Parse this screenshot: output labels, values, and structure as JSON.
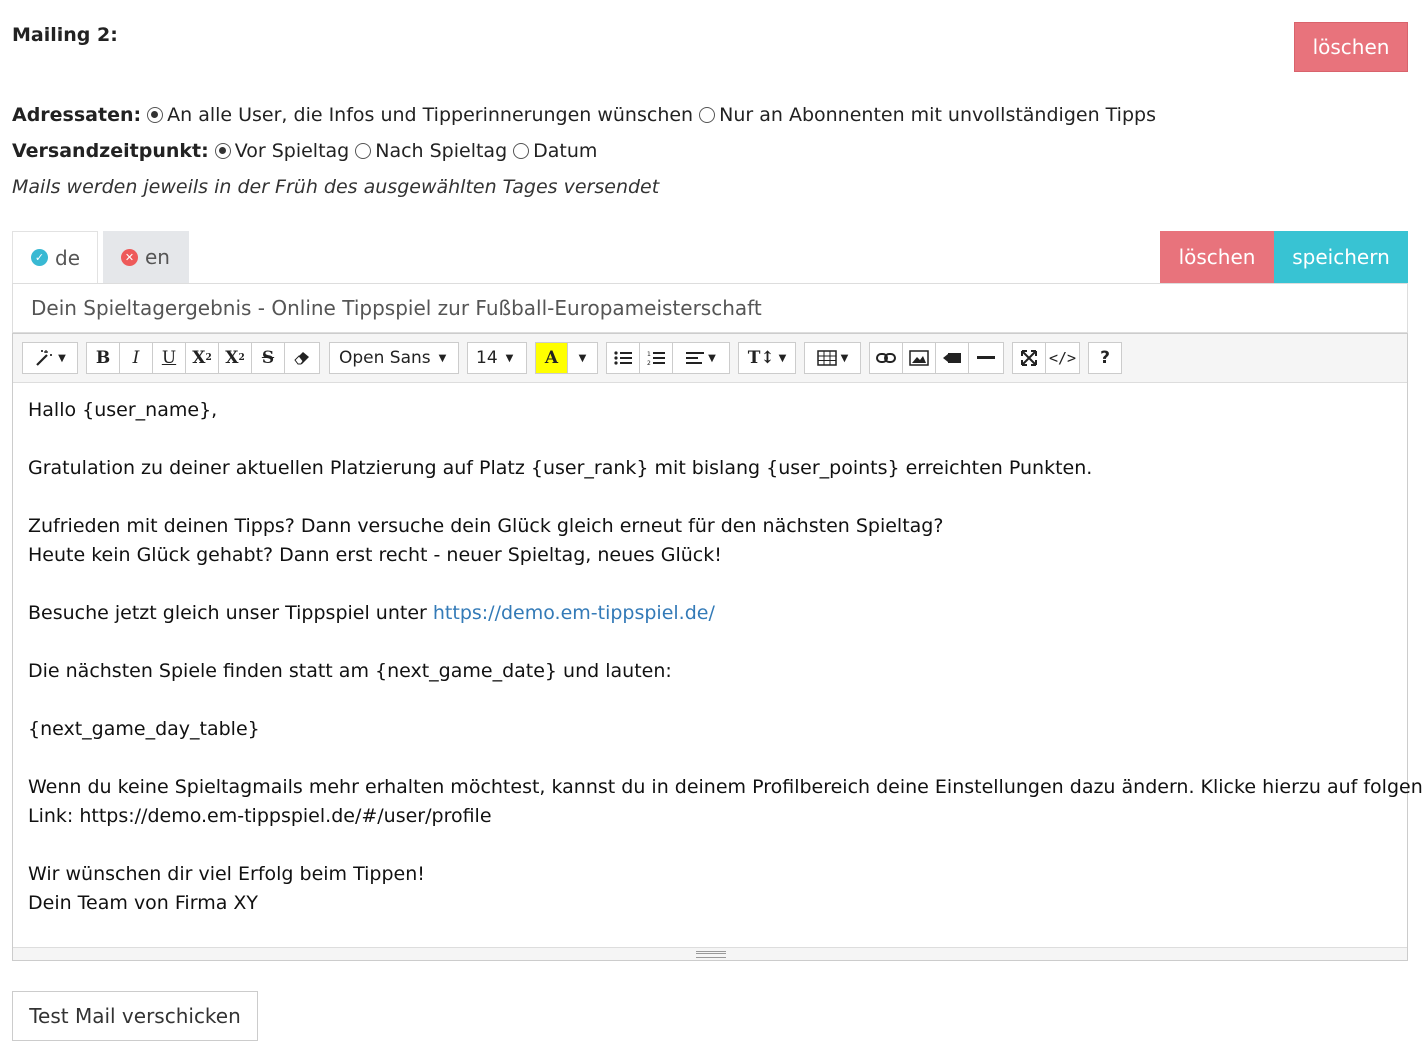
{
  "title": "Mailing 2:",
  "delete_top_label": "löschen",
  "recipients": {
    "label": "Adressaten:",
    "options": [
      "An alle User, die Infos und Tipperinnerungen wünschen",
      "Nur an Abonnenten mit unvollständigen Tipps"
    ],
    "selected": 0
  },
  "send_time": {
    "label": "Versandzeitpunkt:",
    "options": [
      "Vor Spieltag",
      "Nach Spieltag",
      "Datum"
    ],
    "selected": 0
  },
  "note": "Mails werden jeweils in der Früh des ausgewählten Tages versendet",
  "tabs": [
    {
      "label": "de",
      "status": "complete"
    },
    {
      "label": "en",
      "status": "missing"
    }
  ],
  "actions": {
    "delete_label": "löschen",
    "save_label": "speichern"
  },
  "subject": "Dein Spieltagergebnis - Online Tippspiel zur Fußball-Europameisterschaft",
  "toolbar": {
    "font_family": "Open Sans",
    "font_size": "14"
  },
  "body": {
    "greeting": "Hallo {user_name},",
    "congrats": "Gratulation zu deiner aktuellen Platzierung auf Platz {user_rank} mit bislang {user_points} erreichten Punkten.",
    "line3": "Zufrieden mit deinen Tipps? Dann versuche dein Glück gleich erneut für den nächsten Spieltag?",
    "line4": "Heute kein Glück gehabt? Dann erst recht - neuer Spieltag, neues Glück!",
    "visit_prefix": "Besuche jetzt gleich unser Tippspiel unter ",
    "visit_link": "https://demo.em-tippspiel.de/",
    "next_games": "Die nächsten Spiele finden statt am {next_game_date} und lauten:",
    "table_placeholder": "{next_game_day_table}",
    "unsubscribe_1": "Wenn du keine Spieltagmails mehr erhalten möchtest, kannst du in deinem Profilbereich deine Einstellungen dazu ändern. Klicke hierzu auf folgenden",
    "unsubscribe_2": "Link: https://demo.em-tippspiel.de/#/user/profile",
    "closing_1": "Wir wünschen dir viel Erfolg beim Tippen!",
    "closing_2": "Dein Team von Firma XY"
  },
  "test_mail_label": "Test Mail verschicken"
}
